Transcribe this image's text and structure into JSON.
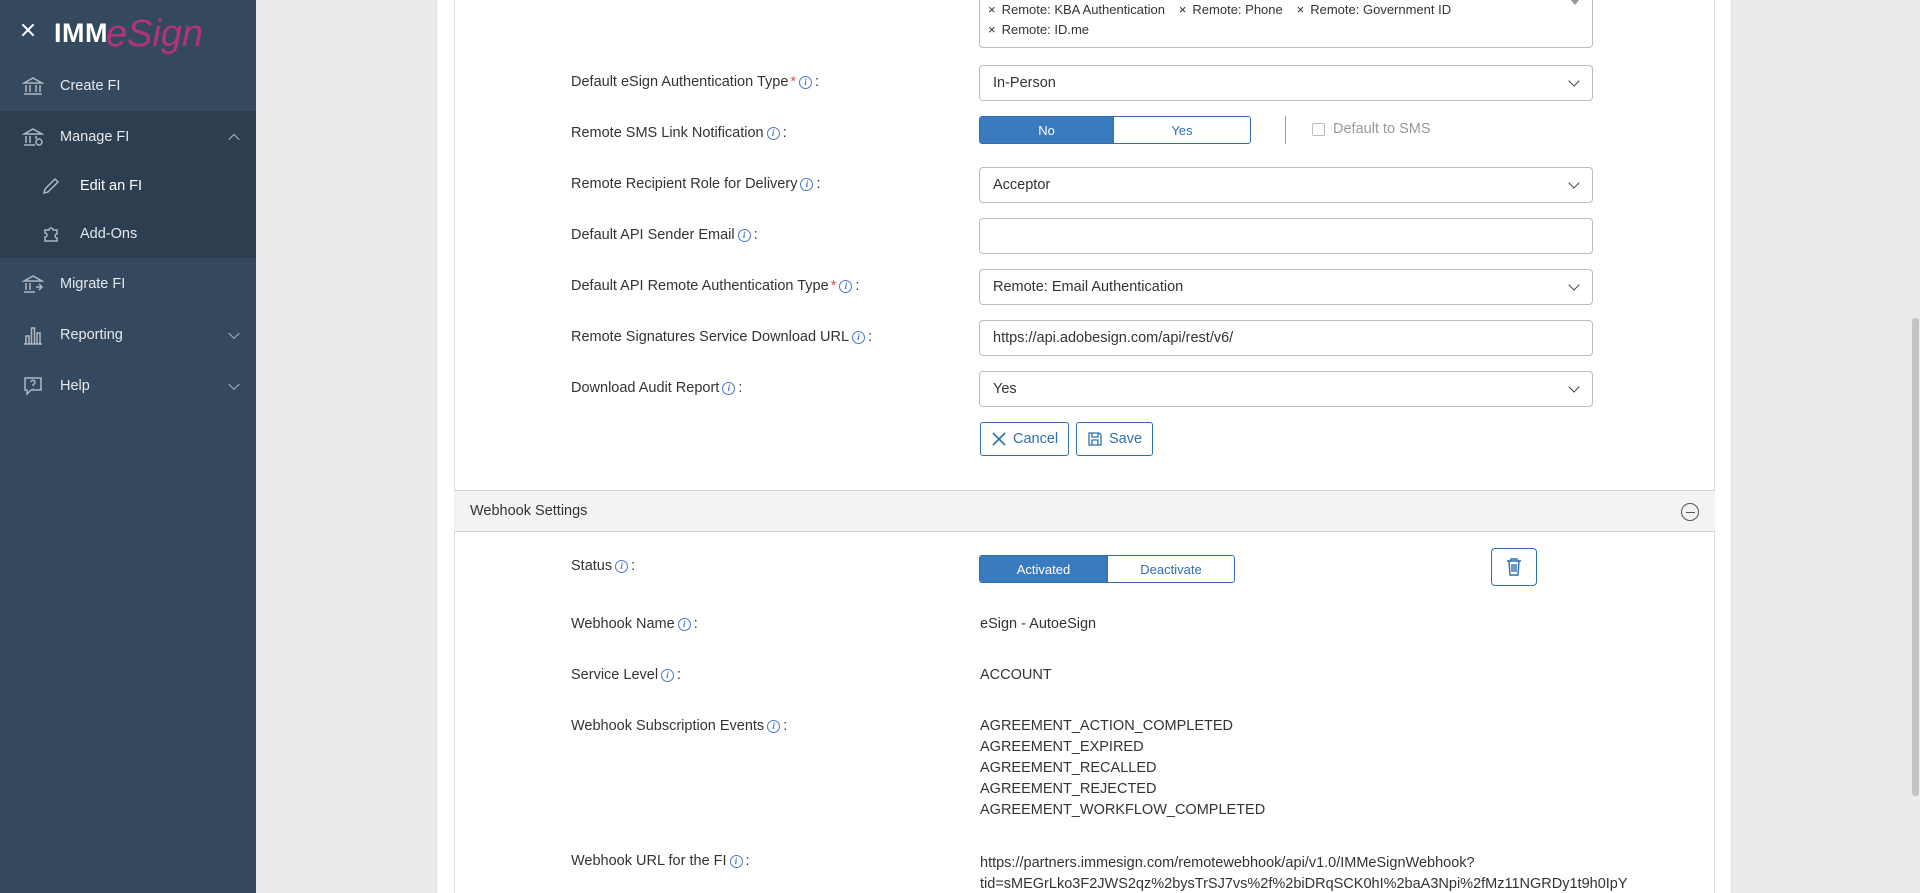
{
  "sidebar": {
    "logo": {
      "imm": "IMM",
      "esign": "eSign"
    },
    "items": [
      {
        "label": "Create FI",
        "icon": "bank-icon"
      },
      {
        "label": "Manage FI",
        "icon": "bank-gear-icon"
      },
      {
        "label": "Edit an FI",
        "icon": "pencil-icon"
      },
      {
        "label": "Add-Ons",
        "icon": "puzzle-icon"
      },
      {
        "label": "Migrate FI",
        "icon": "bank-arrow-icon"
      },
      {
        "label": "Reporting",
        "icon": "bar-chart-icon"
      },
      {
        "label": "Help",
        "icon": "help-bubble-icon"
      }
    ]
  },
  "form": {
    "auth_chips": [
      "Remote: KBA Authentication",
      "Remote: Phone",
      "Remote: Government ID",
      "Remote: ID.me"
    ],
    "default_auth_type": {
      "label": "Default eSign Authentication Type",
      "value": "In-Person"
    },
    "sms_link": {
      "label": "Remote SMS Link Notification",
      "no": "No",
      "yes": "Yes",
      "selected": "No",
      "default_sms": "Default to SMS"
    },
    "recipient_role": {
      "label": "Remote Recipient Role for Delivery",
      "value": "Acceptor"
    },
    "api_sender_email": {
      "label": "Default API Sender Email",
      "value": ""
    },
    "api_remote_auth": {
      "label": "Default API Remote Authentication Type",
      "value": "Remote: Email Authentication"
    },
    "download_url": {
      "label": "Remote Signatures Service Download URL",
      "value": "https://api.adobesign.com/api/rest/v6/"
    },
    "audit_report": {
      "label": "Download Audit Report",
      "value": "Yes"
    },
    "cancel": "Cancel",
    "save": "Save"
  },
  "webhook": {
    "title": "Webhook Settings",
    "status": {
      "label": "Status",
      "activated": "Activated",
      "deactivate": "Deactivate",
      "selected": "Activated"
    },
    "name": {
      "label": "Webhook Name",
      "value": "eSign - AutoeSign"
    },
    "service_level": {
      "label": "Service Level",
      "value": "ACCOUNT"
    },
    "events": {
      "label": "Webhook Subscription Events",
      "values": [
        "AGREEMENT_ACTION_COMPLETED",
        "AGREEMENT_EXPIRED",
        "AGREEMENT_RECALLED",
        "AGREEMENT_REJECTED",
        "AGREEMENT_WORKFLOW_COMPLETED"
      ]
    },
    "url": {
      "label": "Webhook URL for the FI",
      "line1": "https://partners.immesign.com/remotewebhook/api/v1.0/IMMeSignWebhook?",
      "line2": "tid=sMEGrLko3F2JWS2qz%2bysTrSJ7vs%2f%2biDRqSCK0hI%2baA3Npi%2fMz11NGRDy1t9h0IpY"
    }
  },
  "colors": {
    "sidebar": "#34495e",
    "accent": "#3a7bc0",
    "brand": "#b3327c"
  }
}
